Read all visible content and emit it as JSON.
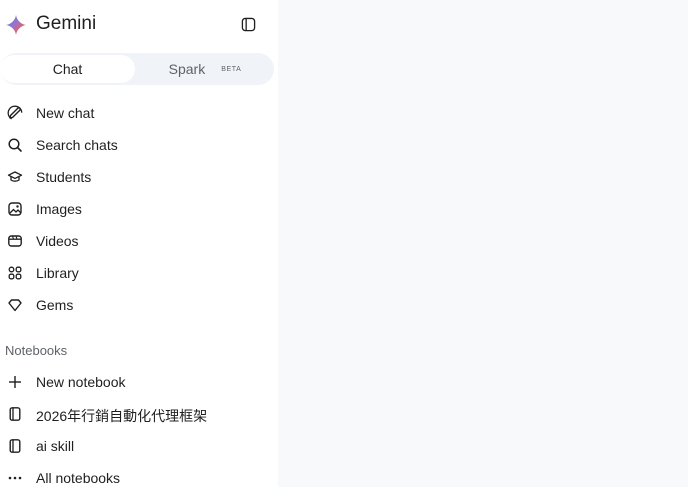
{
  "header": {
    "app_title": "Gemini"
  },
  "mode_toggle": {
    "chat_label": "Chat",
    "spark_label": "Spark",
    "spark_badge": "BETA",
    "selected": "Chat"
  },
  "nav": {
    "new_chat": "New chat",
    "search_chats": "Search chats",
    "students": "Students",
    "images": "Images",
    "videos": "Videos",
    "library": "Library",
    "gems": "Gems"
  },
  "notebooks": {
    "heading": "Notebooks",
    "new_notebook": "New notebook",
    "items": [
      {
        "label": "2026年行銷自動化代理框架"
      },
      {
        "label": "ai skill"
      }
    ],
    "all_notebooks": "All notebooks"
  },
  "colors": {
    "toggle_bg": "#f0f4f9",
    "main_bg": "#f8f9fa",
    "text": "#1f1f1f",
    "muted": "#5f6368"
  }
}
